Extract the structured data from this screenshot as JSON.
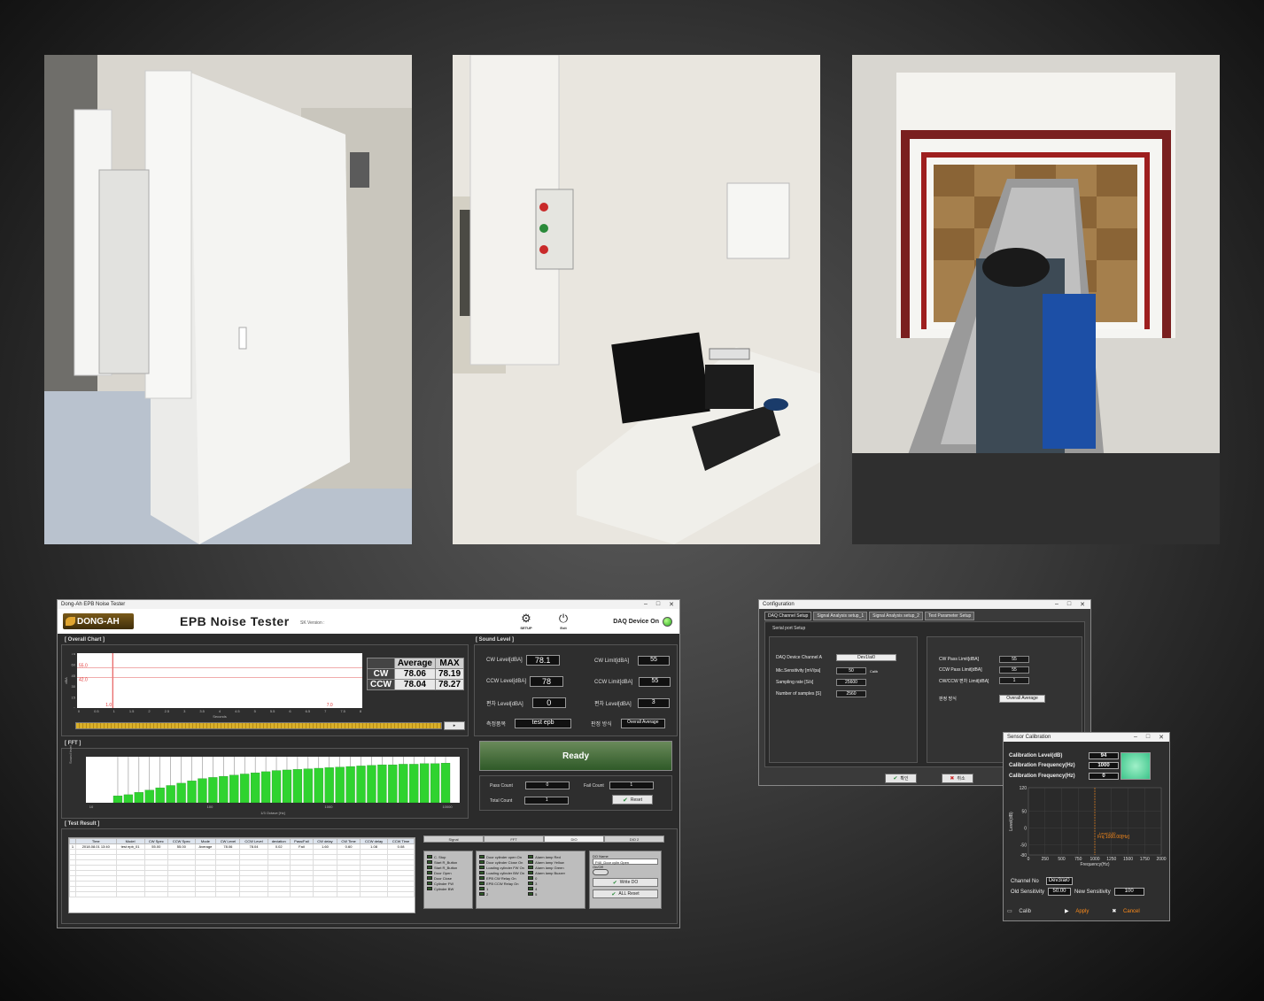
{
  "main_window": {
    "title": "Dong-Ah EPB Noise Tester",
    "logo_text": "DONG-AH",
    "app_title": "EPB Noise Tester",
    "version_label": "SK Version :",
    "setup_label": "SETUP",
    "exit_label": "Exit",
    "daq_status": "DAQ Device On",
    "overall_chart_label": "[ Overall Chart ]",
    "stats": {
      "headers": [
        "Average",
        "MAX"
      ],
      "rows": [
        {
          "label": "CW",
          "average": "78.06",
          "max": "78.19"
        },
        {
          "label": "CCW",
          "average": "78.04",
          "max": "78.27"
        }
      ]
    },
    "sound_level_label": "[ Sound Level ]",
    "sound_levels": [
      {
        "label": "CW Level[dBA]",
        "value": "78.1",
        "limit_label": "CW Limit[dBA]",
        "limit": "55"
      },
      {
        "label": "CCW Level[dBA]",
        "value": "78",
        "limit_label": "CCW Limit[dBA]",
        "limit": "55"
      },
      {
        "label": "편차 Level[dBA]",
        "value": "0",
        "limit_label": "편차 Level[dBA]",
        "limit": "3"
      }
    ],
    "measure_label": "측정품목",
    "measure_value": "test epb",
    "judge_label": "판정 방식",
    "judge_value": "Overall Average",
    "status": "Ready",
    "counts": {
      "pass_label": "Pass Count",
      "pass_value": "0",
      "fail_label": "Fail Count",
      "fail_value": "1",
      "total_label": "Total Count",
      "total_value": "1",
      "reset_label": "Reset"
    },
    "fft_label": "[ FFT ]",
    "test_result_label": "[ Test Result ]",
    "result_columns": [
      "",
      "Time",
      "Model",
      "CW Spec",
      "CCW Spec",
      "Mode",
      "CW Level",
      "CCW Level",
      "deviation",
      "Pass/Fail",
      "CW delay",
      "CW Time",
      "CCW delay",
      "CCW Time"
    ],
    "result_rows": [
      [
        "1",
        "2018.08.01 13:40",
        "test epb_01",
        "55.00",
        "55.00",
        "Average",
        "78.06",
        "78.04",
        "0.02",
        "Fail",
        "1.60",
        "0.60",
        "1.08",
        "0.08"
      ]
    ],
    "io_tabs": [
      "Signal",
      "FFT",
      "DIO",
      "DIO 2"
    ],
    "di_items": [
      "C. Stop",
      "Start R_Button",
      "Start R_Button",
      "Door Open",
      "Door Close",
      "Cylinder FW",
      "Cylinder BW"
    ],
    "do_items_left": [
      "Door cylinder open On",
      "Door cylinder Close On",
      "Loading cylinder FW On",
      "Loading cylinder BW On",
      "EPB CW Relay On",
      "EPB CCW Relay On",
      "1",
      "2"
    ],
    "do_items_right": [
      "Alarm lamp Red",
      "Alarm lamp Yellow",
      "Alarm lamp Green",
      "Alarm lamp Buzzer",
      "0",
      "3",
      "4",
      "5"
    ],
    "do_name_label": "DO Name",
    "do_name_value": "P40_Door cylin Open",
    "do_onoff_label": "On/Off",
    "write_do_label": "Write DO",
    "all_reset_label": "ALL Reset"
  },
  "overall_chart": {
    "type": "line",
    "y_axis_label": "dBA",
    "x_axis_label": "Seconds",
    "x_ticks": [
      "0",
      "0.5",
      "1",
      "1.5",
      "2",
      "2.5",
      "3",
      "3.5",
      "4",
      "4.5",
      "5",
      "5.5",
      "6",
      "6.5",
      "7",
      "7.5",
      "8"
    ],
    "y_ticks": [
      "0",
      "15",
      "30",
      "45",
      "60",
      "75"
    ],
    "annotations": [
      "55.0",
      "42.0",
      "1.0",
      "7.0"
    ],
    "xlim": [
      0,
      8
    ],
    "ylim": [
      0,
      75
    ]
  },
  "fft_chart": {
    "type": "bar",
    "y_axis_label": "Sound level",
    "x_axis_label": "1/3 Octave [Hz]",
    "x_ticks": [
      "10",
      "100",
      "1000",
      "10000"
    ],
    "values": [
      12,
      14,
      18,
      22,
      26,
      30,
      34,
      38,
      42,
      44,
      46,
      48,
      50,
      52,
      54,
      56,
      57,
      58,
      59,
      60,
      61,
      62,
      63,
      64,
      65,
      66,
      66,
      67,
      67,
      68,
      68,
      69
    ],
    "ylim": [
      0,
      80
    ],
    "bar_color": "#2fd32f"
  },
  "config_window": {
    "title": "Configuration",
    "tabs": [
      "DAQ Channel Setup",
      "Signal Analysis setup_1",
      "Signal Analysis setup_2",
      "Test Parameter Setup"
    ],
    "subtitle": "Serial port Setup",
    "left_fields": [
      {
        "label": "DAQ Device Channel A",
        "value": "Dev1/ai0"
      },
      {
        "label": "Mic.Sensitivity [mV/pa]",
        "value": "50"
      },
      {
        "label": "Sampling rate [S/s]",
        "value": "25600"
      },
      {
        "label": "Number of samples [S]",
        "value": "2560"
      }
    ],
    "calib_label": "Calib",
    "right_fields": [
      {
        "label": "CW Pass Limit[dBA]",
        "value": "55"
      },
      {
        "label": "CCW Pass Limit[dBA]",
        "value": "55"
      },
      {
        "label": "CW/CCW 편차 Limit[dBA]",
        "value": "1"
      }
    ],
    "judge_label": "판정 방식",
    "judge_value": "Overall Average",
    "ok_label": "확인",
    "cancel_label": "취소"
  },
  "calib_window": {
    "title": "Sensor Calibration",
    "level_label": "Calibration Level(dB)",
    "level_value": "94",
    "freq_label": "Calibration Frequency(Hz)",
    "freq_value": "1000",
    "freq2_label": "Calibration Frequency(Hz)",
    "freq2_value": "0",
    "chart_y_label": "Level(dB)",
    "chart_x_label": "Frequency(Hz)",
    "chart_annotation_1": "Level 0.00",
    "chart_annotation_2": "Frq 1000.00[Hz]",
    "channel_label": "Channel  No",
    "channel_value": "Dev3/ai0",
    "old_label": "Old Sensitivity",
    "old_value": "50.00",
    "new_label": "New Sensitivity",
    "new_value": "100",
    "calib_label": "Calib",
    "apply_label": "Apply",
    "cancel_label": "Cancel"
  },
  "calib_chart": {
    "type": "line",
    "x_ticks": [
      "0",
      "250",
      "500",
      "750",
      "1000",
      "1250",
      "1500",
      "1750",
      "2000"
    ],
    "y_ticks": [
      "120",
      "50",
      "0",
      "-50",
      "-80"
    ],
    "xlim": [
      0,
      2000
    ],
    "ylim": [
      -80,
      120
    ],
    "marker_x": 1000
  }
}
